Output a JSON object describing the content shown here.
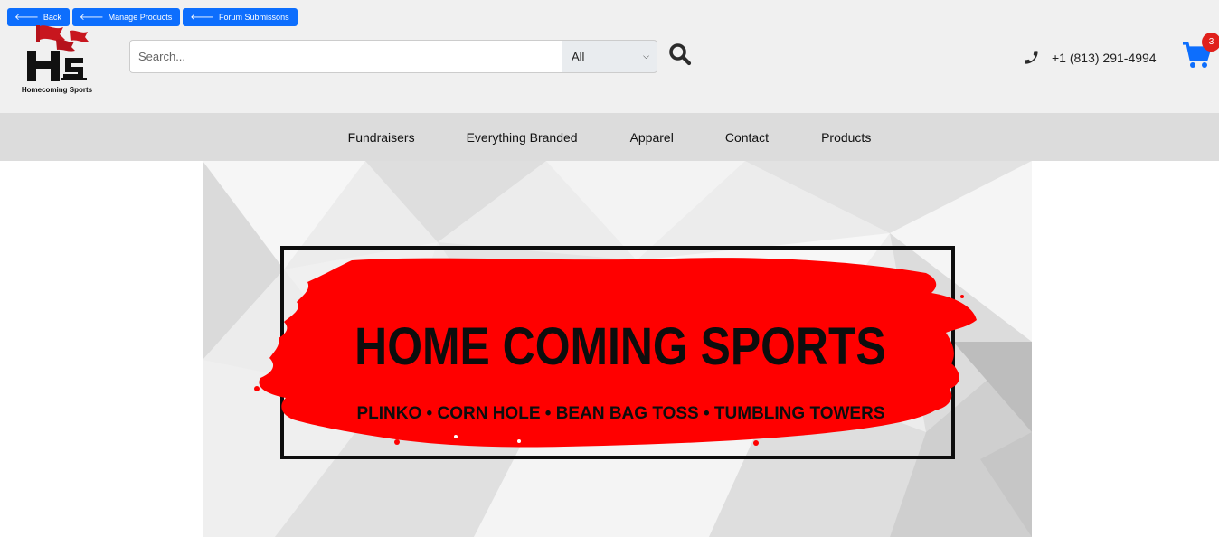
{
  "admin_bar": {
    "buttons": [
      "Back",
      "Manage Products",
      "Forum Submissons"
    ]
  },
  "logo": {
    "text": "Homecoming Sports"
  },
  "search": {
    "placeholder": "Search...",
    "category": "All"
  },
  "contact": {
    "phone": "+1 (813) 291-4994"
  },
  "cart": {
    "count": "3"
  },
  "nav": {
    "items": [
      "Fundraisers",
      "Everything Branded",
      "Apparel",
      "Contact",
      "Products"
    ]
  },
  "hero": {
    "title": "HOME COMING SPORTS",
    "subtitle": "PLINKO • CORN HOLE • BEAN BAG TOSS • TUMBLING TOWERS"
  },
  "colors": {
    "admin_button": "#0d6efd",
    "header_bg": "#f0f0f0",
    "nav_bg": "#dcdcdc",
    "brand_red": "#ff0000",
    "cart_blue": "#0d6efd",
    "badge_red": "#e0201b"
  }
}
